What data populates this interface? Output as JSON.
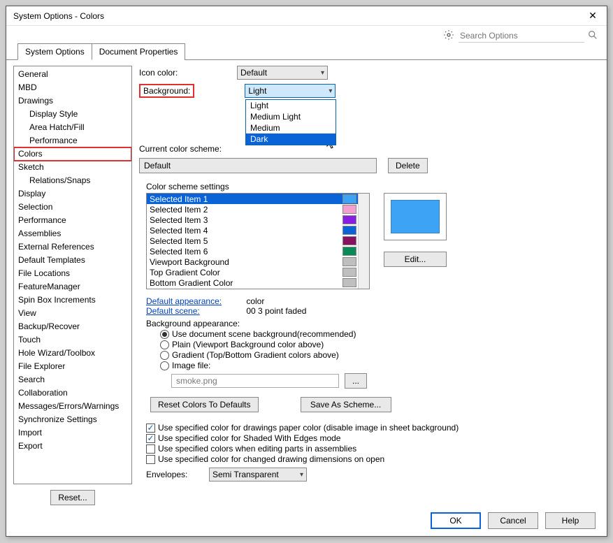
{
  "window": {
    "title": "System Options - Colors"
  },
  "search": {
    "placeholder": "Search Options"
  },
  "tabs": {
    "system_options": "System Options",
    "document_properties": "Document Properties"
  },
  "sidebar": {
    "items": [
      {
        "label": "General",
        "indent": false
      },
      {
        "label": "MBD",
        "indent": false
      },
      {
        "label": "Drawings",
        "indent": false
      },
      {
        "label": "Display Style",
        "indent": true
      },
      {
        "label": "Area Hatch/Fill",
        "indent": true
      },
      {
        "label": "Performance",
        "indent": true
      },
      {
        "label": "Colors",
        "indent": false,
        "selected": true
      },
      {
        "label": "Sketch",
        "indent": false
      },
      {
        "label": "Relations/Snaps",
        "indent": true
      },
      {
        "label": "Display",
        "indent": false
      },
      {
        "label": "Selection",
        "indent": false
      },
      {
        "label": "Performance",
        "indent": false
      },
      {
        "label": "Assemblies",
        "indent": false
      },
      {
        "label": "External References",
        "indent": false
      },
      {
        "label": "Default Templates",
        "indent": false
      },
      {
        "label": "File Locations",
        "indent": false
      },
      {
        "label": "FeatureManager",
        "indent": false
      },
      {
        "label": "Spin Box Increments",
        "indent": false
      },
      {
        "label": "View",
        "indent": false
      },
      {
        "label": "Backup/Recover",
        "indent": false
      },
      {
        "label": "Touch",
        "indent": false
      },
      {
        "label": "Hole Wizard/Toolbox",
        "indent": false
      },
      {
        "label": "File Explorer",
        "indent": false
      },
      {
        "label": "Search",
        "indent": false
      },
      {
        "label": "Collaboration",
        "indent": false
      },
      {
        "label": "Messages/Errors/Warnings",
        "indent": false
      },
      {
        "label": "Synchronize Settings",
        "indent": false
      },
      {
        "label": "Import",
        "indent": false
      },
      {
        "label": "Export",
        "indent": false
      }
    ],
    "reset_label": "Reset..."
  },
  "colors": {
    "icon_color_label": "Icon color:",
    "icon_color_value": "Default",
    "background_label": "Background:",
    "background_value": "Light",
    "background_options": [
      "Light",
      "Medium Light",
      "Medium",
      "Dark"
    ],
    "background_highlight_index": 3,
    "current_scheme_label": "Current color scheme:",
    "current_scheme_value": "Default",
    "delete_label": "Delete",
    "settings_header": "Color scheme settings",
    "scheme_items": [
      {
        "name": "Selected Item 1",
        "color": "#3da3f5",
        "selected": true
      },
      {
        "name": "Selected Item 2",
        "color": "#f59ed0"
      },
      {
        "name": "Selected Item 3",
        "color": "#8a1ee0"
      },
      {
        "name": "Selected Item 4",
        "color": "#0a64d8"
      },
      {
        "name": "Selected Item 5",
        "color": "#8a1060"
      },
      {
        "name": "Selected Item 6",
        "color": "#0a8a56"
      },
      {
        "name": "Viewport Background",
        "color": "#bfbfbf"
      },
      {
        "name": "Top Gradient Color",
        "color": "#bfbfbf"
      },
      {
        "name": "Bottom Gradient Color",
        "color": "#bfbfbf"
      }
    ],
    "edit_label": "Edit...",
    "default_appearance_label": "Default appearance:",
    "default_appearance_value": "color",
    "default_scene_label": "Default scene:",
    "default_scene_value": "00 3 point faded",
    "bg_appearance_label": "Background appearance:",
    "bg_radios": [
      "Use document scene background(recommended)",
      "Plain (Viewport Background color above)",
      "Gradient (Top/Bottom Gradient colors above)",
      "Image file:"
    ],
    "image_file_value": "smoke.png",
    "browse_label": "...",
    "reset_defaults_label": "Reset Colors To Defaults",
    "save_scheme_label": "Save As Scheme...",
    "checks": [
      {
        "label": "Use specified color for drawings paper color (disable image in sheet background)",
        "checked": true
      },
      {
        "label": "Use specified color for Shaded With Edges mode",
        "checked": true
      },
      {
        "label": "Use specified colors when editing parts in assemblies",
        "checked": false
      },
      {
        "label": "Use specified color for changed drawing dimensions on open",
        "checked": false
      }
    ],
    "envelopes_label": "Envelopes:",
    "envelopes_value": "Semi Transparent"
  },
  "footer": {
    "ok": "OK",
    "cancel": "Cancel",
    "help": "Help"
  }
}
